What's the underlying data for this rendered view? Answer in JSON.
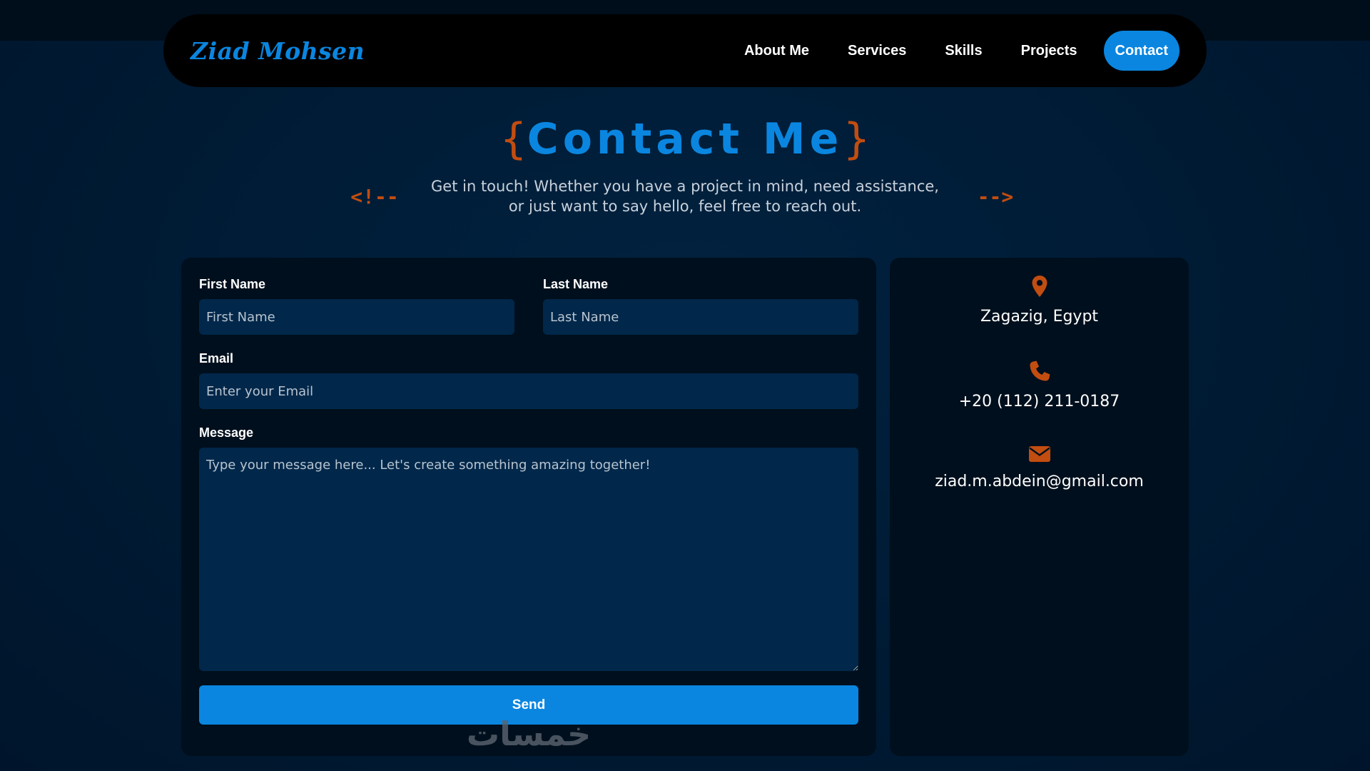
{
  "nav": {
    "brand": "Ziad Mohsen",
    "links": [
      "About Me",
      "Services",
      "Skills",
      "Projects"
    ],
    "active": "Contact"
  },
  "header": {
    "brace_open": "{",
    "title": "Contact Me",
    "brace_close": "}",
    "comment_open": "<!--",
    "comment_close": "-->",
    "subtitle": "Get in touch! Whether you have a project in mind, need assistance, or just want to say hello, feel free to reach out."
  },
  "form": {
    "first_name_label": "First Name",
    "first_name_placeholder": "First Name",
    "last_name_label": "Last Name",
    "last_name_placeholder": "Last Name",
    "email_label": "Email",
    "email_placeholder": "Enter your Email",
    "message_label": "Message",
    "message_placeholder": "Type your message here... Let's create something amazing together!",
    "send_label": "Send"
  },
  "info": {
    "location": "Zagazig, Egypt",
    "phone": "+20 (112) 211-0187",
    "email": "ziad.m.abdein@gmail.com",
    "icons": [
      "map-pin-icon",
      "phone-icon",
      "envelope-icon"
    ]
  },
  "watermark": "خمسات",
  "colors": {
    "accent_blue": "#0a86e0",
    "accent_orange": "#c24d10",
    "background": "#001a33",
    "card": "#000f1d",
    "input": "#01274a"
  }
}
